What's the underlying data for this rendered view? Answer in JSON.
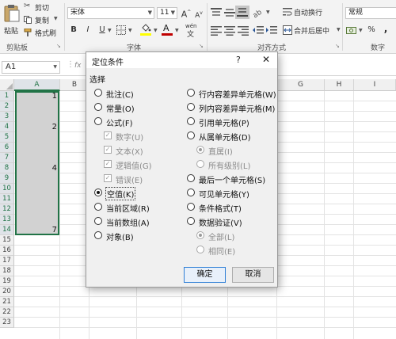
{
  "ribbon": {
    "clipboard": {
      "paste": "粘贴",
      "cut": "剪切",
      "copy": "复制",
      "format_painter": "格式刷",
      "group_label": "剪贴板"
    },
    "font": {
      "font_name": "宋体",
      "font_size": "11",
      "bold": "B",
      "italic": "I",
      "underline": "U",
      "grow": "A",
      "shrink": "A",
      "color_a": "A",
      "wen": "wén",
      "group_label": "字体"
    },
    "alignment": {
      "wrap_text": "自动换行",
      "merge_center": "合并后居中",
      "group_label": "对齐方式"
    },
    "number": {
      "format": "常规",
      "percent": "%",
      "comma": ",",
      "group_label": "数字"
    },
    "accent_color": "#217346",
    "font_color": "#c00000",
    "fill_color": "#ffff00"
  },
  "formula_bar": {
    "name_box": "A1",
    "fx": "fx"
  },
  "grid": {
    "columns": [
      "A",
      "B",
      "C",
      "D",
      "E",
      "F",
      "G",
      "H",
      "I"
    ],
    "rows": [
      "1",
      "2",
      "3",
      "4",
      "5",
      "6",
      "7",
      "8",
      "9",
      "10",
      "11",
      "12",
      "13",
      "14",
      "15",
      "16",
      "17",
      "18",
      "19",
      "20",
      "21",
      "22",
      "23"
    ],
    "cells": [
      {
        "row": "1",
        "col": "A",
        "value": "1"
      },
      {
        "row": "4",
        "col": "A",
        "value": "2"
      },
      {
        "row": "8",
        "col": "A",
        "value": "4"
      },
      {
        "row": "14",
        "col": "A",
        "value": "7"
      }
    ]
  },
  "dialog": {
    "title": "定位条件",
    "help": "?",
    "close": "✕",
    "section": "选择",
    "left_options": [
      {
        "label": "批注(C)",
        "type": "radio",
        "checked": false,
        "disabled": false
      },
      {
        "label": "常量(O)",
        "type": "radio",
        "checked": false,
        "disabled": false
      },
      {
        "label": "公式(F)",
        "type": "radio",
        "checked": false,
        "disabled": false
      },
      {
        "label": "数字(U)",
        "type": "check",
        "checked": true,
        "disabled": true
      },
      {
        "label": "文本(X)",
        "type": "check",
        "checked": true,
        "disabled": true
      },
      {
        "label": "逻辑值(G)",
        "type": "check",
        "checked": true,
        "disabled": true
      },
      {
        "label": "错误(E)",
        "type": "check",
        "checked": true,
        "disabled": true
      },
      {
        "label": "空值(K)",
        "type": "radio",
        "checked": true,
        "disabled": false
      },
      {
        "label": "当前区域(R)",
        "type": "radio",
        "checked": false,
        "disabled": false
      },
      {
        "label": "当前数组(A)",
        "type": "radio",
        "checked": false,
        "disabled": false
      },
      {
        "label": "对象(B)",
        "type": "radio",
        "checked": false,
        "disabled": false
      }
    ],
    "right_options": [
      {
        "label": "行内容差异单元格(W)",
        "type": "radio",
        "checked": false,
        "disabled": false
      },
      {
        "label": "列内容差异单元格(M)",
        "type": "radio",
        "checked": false,
        "disabled": false
      },
      {
        "label": "引用单元格(P)",
        "type": "radio",
        "checked": false,
        "disabled": false
      },
      {
        "label": "从属单元格(D)",
        "type": "radio",
        "checked": false,
        "disabled": false
      },
      {
        "label": "直属(I)",
        "type": "radio",
        "checked": true,
        "disabled": true
      },
      {
        "label": "所有级别(L)",
        "type": "radio",
        "checked": false,
        "disabled": true
      },
      {
        "label": "最后一个单元格(S)",
        "type": "radio",
        "checked": false,
        "disabled": false
      },
      {
        "label": "可见单元格(Y)",
        "type": "radio",
        "checked": false,
        "disabled": false
      },
      {
        "label": "条件格式(T)",
        "type": "radio",
        "checked": false,
        "disabled": false
      },
      {
        "label": "数据验证(V)",
        "type": "radio",
        "checked": false,
        "disabled": false
      },
      {
        "label": "全部(L)",
        "type": "radio",
        "checked": true,
        "disabled": true
      },
      {
        "label": "相同(E)",
        "type": "radio",
        "checked": false,
        "disabled": true
      }
    ],
    "ok": "确定",
    "cancel": "取消"
  }
}
